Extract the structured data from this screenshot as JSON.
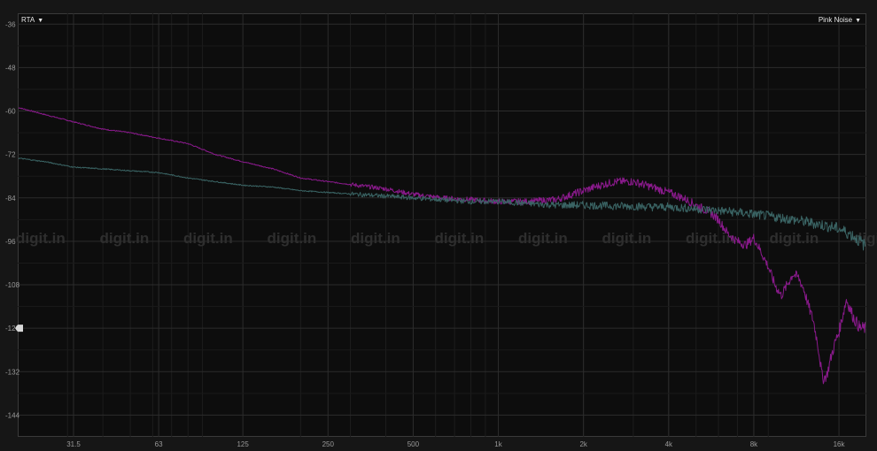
{
  "controls": {
    "mode_label": "RTA",
    "mode_caret": "▼",
    "source_label": "Pink Noise",
    "source_caret": "▼"
  },
  "watermark_text": "digit.in",
  "colors": {
    "background": "#0d0d0d",
    "grid": "#2c2c2c",
    "series_purple": "#8a1a8c",
    "series_teal": "#3a6464"
  },
  "chart_data": {
    "type": "line",
    "title": "",
    "xlabel": "",
    "ylabel": "",
    "x_scale": "log",
    "xlim": [
      20,
      20000
    ],
    "ylim": [
      -150,
      -33
    ],
    "x_ticks": [
      {
        "value": 31.5,
        "label": "31.5"
      },
      {
        "value": 63,
        "label": "63"
      },
      {
        "value": 125,
        "label": "125"
      },
      {
        "value": 250,
        "label": "250"
      },
      {
        "value": 500,
        "label": "500"
      },
      {
        "value": 1000,
        "label": "1k"
      },
      {
        "value": 2000,
        "label": "2k"
      },
      {
        "value": 4000,
        "label": "4k"
      },
      {
        "value": 8000,
        "label": "8k"
      },
      {
        "value": 16000,
        "label": "16k"
      }
    ],
    "y_ticks": [
      {
        "value": -36,
        "label": "-36"
      },
      {
        "value": -48,
        "label": "-48"
      },
      {
        "value": -60,
        "label": "-60"
      },
      {
        "value": -72,
        "label": "-72"
      },
      {
        "value": -84,
        "label": "-84"
      },
      {
        "value": -96,
        "label": "-96"
      },
      {
        "value": -108,
        "label": "-108"
      },
      {
        "value": -120,
        "label": "-120"
      },
      {
        "value": -132,
        "label": "-132"
      },
      {
        "value": -144,
        "label": "-144"
      }
    ],
    "grid": true,
    "reference_marker_y": -120,
    "series": [
      {
        "color": "#8a1a8c",
        "x": [
          20,
          25,
          31.5,
          40,
          50,
          63,
          80,
          100,
          125,
          160,
          200,
          250,
          315,
          400,
          500,
          630,
          800,
          1000,
          1250,
          1600,
          2000,
          2300,
          2600,
          3000,
          3500,
          4000,
          4500,
          5000,
          5600,
          6000,
          6500,
          7000,
          7500,
          8000,
          8500,
          9000,
          9500,
          10000,
          10500,
          11000,
          11500,
          12000,
          12500,
          13000,
          13500,
          14000,
          14500,
          15000,
          15500,
          16000,
          17000,
          18000,
          19000,
          20000
        ],
        "y": [
          -59,
          -61,
          -63,
          -65,
          -66,
          -67.5,
          -69,
          -72,
          -74,
          -76,
          -78.5,
          -79.5,
          -80.5,
          -81.5,
          -83,
          -84,
          -84.5,
          -85,
          -85,
          -84.5,
          -82,
          -80.5,
          -79.5,
          -79.5,
          -81,
          -82.5,
          -84,
          -86,
          -88,
          -90,
          -94,
          -96,
          -97,
          -95,
          -99,
          -103,
          -108,
          -111,
          -108,
          -105,
          -106,
          -109,
          -114,
          -118,
          -125,
          -134,
          -133,
          -128,
          -124,
          -121,
          -112,
          -117,
          -120,
          -120
        ]
      },
      {
        "color": "#3a6464",
        "x": [
          20,
          25,
          31.5,
          40,
          50,
          63,
          80,
          100,
          125,
          160,
          200,
          250,
          315,
          400,
          500,
          630,
          800,
          1000,
          1250,
          1600,
          2000,
          2500,
          3000,
          3500,
          4000,
          5000,
          6000,
          7000,
          8000,
          9000,
          10000,
          11000,
          12000,
          13000,
          14000,
          15000,
          16000,
          17000,
          18000,
          19000,
          20000
        ],
        "y": [
          -73,
          -74,
          -75.5,
          -76,
          -76.5,
          -77,
          -78.5,
          -79.5,
          -80.5,
          -81,
          -82,
          -82.5,
          -83,
          -83.5,
          -84,
          -84.5,
          -85,
          -85,
          -85.5,
          -86,
          -86,
          -86.2,
          -86.3,
          -86.5,
          -86.5,
          -87,
          -87.5,
          -88,
          -88.5,
          -89,
          -89.5,
          -90,
          -90.5,
          -91,
          -91.5,
          -92,
          -92.5,
          -93.5,
          -94.5,
          -96,
          -97.5
        ]
      }
    ]
  }
}
